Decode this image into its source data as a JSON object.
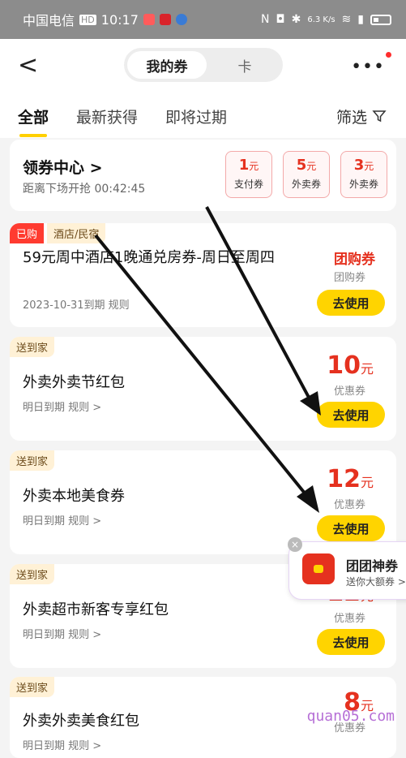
{
  "status": {
    "carrier": "中国电信",
    "hd": "HD",
    "time": "10:17",
    "speed": "6.3 K/s"
  },
  "topbar": {
    "back": "<",
    "seg_active": "我的券",
    "seg_other": "卡",
    "more": "•••"
  },
  "tabs": [
    "全部",
    "最新获得",
    "即将过期"
  ],
  "filter": "筛选",
  "center": {
    "title": "领券中心 >",
    "subtitle": "距离下场开抢 00:42:45",
    "mini": [
      {
        "amount": "1",
        "unit": "元",
        "label": "支付券"
      },
      {
        "amount": "5",
        "unit": "元",
        "label": "外卖券"
      },
      {
        "amount": "3",
        "unit": "元",
        "label": "外卖券"
      }
    ]
  },
  "coupons": [
    {
      "tag1": "已购",
      "tag2": "酒店/民宿",
      "title": "59元周中酒店1晚通兑房券-周日至周四",
      "meta": "2023-10-31到期  规则",
      "amount": "团购券",
      "type": "团购券",
      "button": "去使用"
    },
    {
      "tag1": "送到家",
      "title": "外卖外卖节红包",
      "meta": "明日到期  规则 >",
      "amount": "10",
      "unit": "元",
      "type": "优惠券",
      "button": "去使用"
    },
    {
      "tag1": "送到家",
      "title": "外卖本地美食券",
      "meta": "明日到期  规则 >",
      "amount": "12",
      "unit": "元",
      "type": "优惠券",
      "button": "去使用"
    },
    {
      "tag1": "送到家",
      "title": "外卖超市新客专享红包",
      "meta": "明日到期  规则 >",
      "amount": "12",
      "unit": "元",
      "type": "优惠券",
      "button": "去使用"
    },
    {
      "tag1": "送到家",
      "title": "外卖外卖美食红包",
      "meta": "明日到期  规则 >",
      "amount": "8",
      "unit": "元",
      "type": "优惠券",
      "button": "去使用"
    }
  ],
  "floating": {
    "title": "团团神券",
    "subtitle": "送你大额券 >",
    "close": "×"
  },
  "watermark": "quan05.com",
  "colors": {
    "accent": "#ffd400",
    "price": "#e5311f"
  }
}
